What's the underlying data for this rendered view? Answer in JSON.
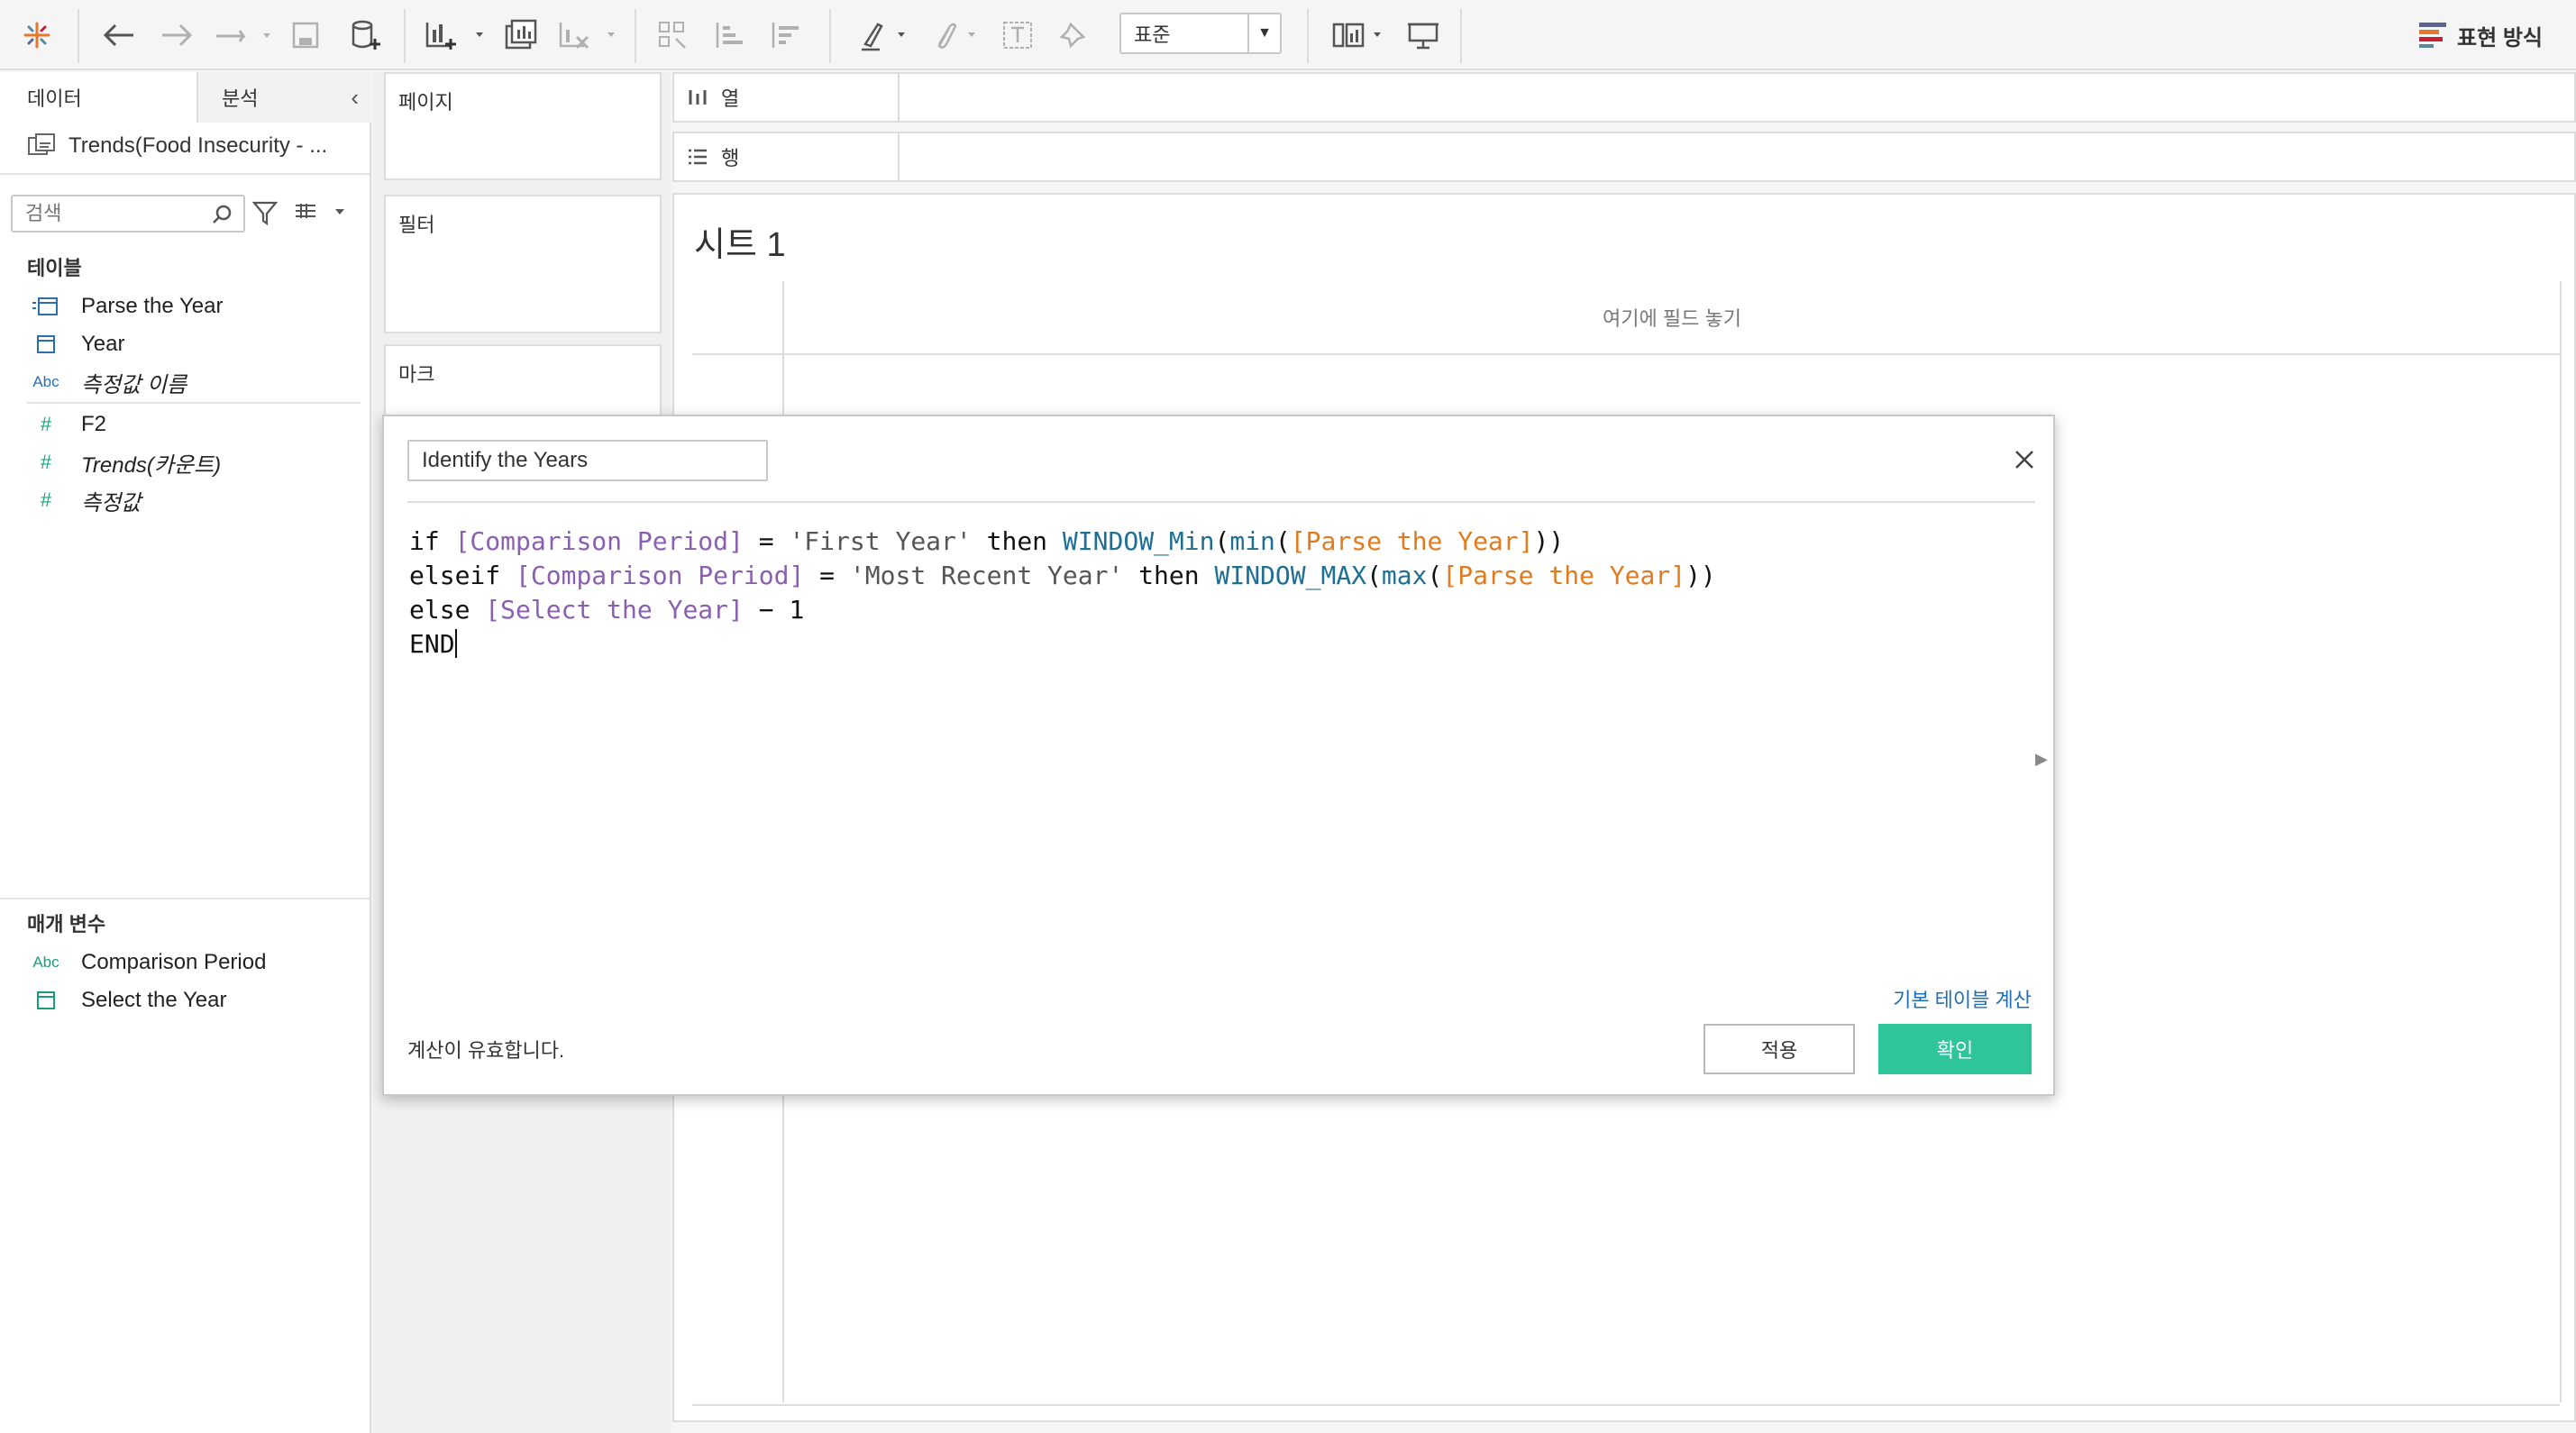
{
  "toolbar": {
    "format_select": "표준",
    "show_me_label": "표현 방식"
  },
  "data_pane": {
    "tabs": [
      {
        "label": "데이터"
      },
      {
        "label": "분석"
      }
    ],
    "datasource": "Trends(Food Insecurity - ...",
    "search": {
      "placeholder": "검색"
    },
    "tables_title": "테이블",
    "fields": [
      {
        "icon": "calendar-icon",
        "label": "Parse the Year",
        "italic": false
      },
      {
        "icon": "calendar-icon",
        "label": "Year",
        "italic": false
      },
      {
        "icon": "Abc",
        "label": "측정값 이름",
        "italic": true
      },
      {
        "icon": "#",
        "label": "F2",
        "italic": false
      },
      {
        "icon": "#",
        "label": "Trends(카운트)",
        "italic": true
      },
      {
        "icon": "#",
        "label": "측정값",
        "italic": true
      }
    ],
    "parameters_title": "매개 변수",
    "parameters": [
      {
        "icon": "Abc",
        "label": "Comparison Period"
      },
      {
        "icon": "calendar-icon",
        "label": "Select the Year"
      }
    ]
  },
  "shelves": {
    "pages": "페이지",
    "filters": "필터",
    "marks": "마크",
    "columns": "열",
    "rows": "행"
  },
  "sheet": {
    "title": "시트 1",
    "drop_hint": "여기에 필드 놓기"
  },
  "dialog": {
    "calc_name": "Identify the Years",
    "default_table_calc_link": "기본 테이블 계산",
    "status": "계산이 유효합니다.",
    "apply_label": "적용",
    "ok_label": "확인",
    "code": {
      "l1_kw1": "if ",
      "l1_field": "[Comparison Period]",
      "l1_eq": " = ",
      "l1_str": "'First Year'",
      "l1_then": " then ",
      "l1_fn": "WINDOW_Min",
      "l1_p1": "(",
      "l1_agg": "min",
      "l1_p2": "(",
      "l1_field2": "[Parse the Year]",
      "l1_end": "))",
      "l2_kw1": "elseif ",
      "l2_field": "[Comparison Period]",
      "l2_eq": " = ",
      "l2_str": "'Most Recent Year'",
      "l2_then": " then ",
      "l2_fn": "WINDOW_MAX",
      "l2_p1": "(",
      "l2_agg": "max",
      "l2_p2": "(",
      "l2_field2": "[Parse the Year]",
      "l2_end": "))",
      "l3_kw1": "else ",
      "l3_field": "[Select the Year]",
      "l3_rest": " − 1",
      "l4": "END"
    }
  },
  "colors": {
    "accent_ok": "#2fc59b",
    "field_purple": "#8a5fb0",
    "field_orange": "#e27a1f",
    "function_blue": "#1f6f95",
    "link_blue": "#1e6fb5"
  }
}
